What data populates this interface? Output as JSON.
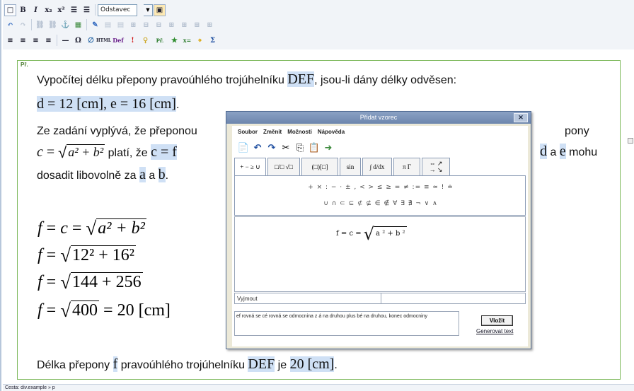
{
  "toolbar": {
    "row1": [
      "□",
      "B",
      "I",
      "x₂",
      "x²",
      "☰",
      "☰"
    ],
    "style_select_value": "Odstavec",
    "row2": [
      "↶",
      "↷",
      "⛓",
      "⛓",
      "⚓",
      "▦",
      "✎",
      "▤",
      "▤",
      "⊞",
      "⊟",
      "⊟",
      "⊞",
      "⊞",
      "⊞",
      "⊞"
    ],
    "row3": [
      "≡",
      "≡",
      "≡",
      "≡",
      "—",
      "Ω",
      "∅",
      "HTML",
      "Def",
      "!",
      "♀",
      "Př.",
      "★",
      "x=",
      "⋄",
      "Σ"
    ]
  },
  "content": {
    "example_tag": "Př.",
    "task_text_pre": "Vypočítej délku přepony pravoúhlého trojúhelníku ",
    "task_triangle": "DEF",
    "task_text_post": ", jsou-li dány délky odvěsen:",
    "given": "d = 12 [cm], e = 16 [cm]",
    "given_end": ".",
    "line3_left": "Ze zadání vyplývá, že přeponou",
    "line3_right": "pony",
    "line4_c": "c",
    "line4_mid": " platí, že ",
    "line4_highlight": "c = f",
    "line4_d": "d",
    "line4_a": " a ",
    "line4_e": "e",
    "line4_end": " mohu",
    "line5_pre": "dosadit libovolně za ",
    "line5_a": "a",
    "line5_mid": " a ",
    "line5_b": "b",
    "line5_end": ".",
    "eq1_f": "f",
    "eq1_eq": "=",
    "eq1_c": "c",
    "eq1_eq2": "=",
    "eq1_rad": "a² + b²",
    "eq2_f": "f",
    "eq2_eq": "=",
    "eq2_rad": "12² + 16²",
    "eq3_f": "f",
    "eq3_eq": "=",
    "eq3_rad": "144 + 256",
    "eq4_f": "f",
    "eq4_eq": "=",
    "eq4_rad": "400",
    "eq4_rest": "= 20 [cm]",
    "answer_pre": "Délka přepony ",
    "answer_f": "f",
    "answer_mid": " pravoúhlého trojúhelníku ",
    "answer_triangle": "DEF",
    "answer_je": " je ",
    "answer_value": "20 [cm]",
    "answer_end": "."
  },
  "status_path": "Cesta: div.example » p",
  "dialog": {
    "title": "Přidat vzorec",
    "close": "✕",
    "menu": [
      "Soubor",
      "Změnit",
      "Možnosti",
      "Nápověda"
    ],
    "icons": [
      "📄",
      "↶",
      "↷",
      "✂",
      "⎘",
      "📋",
      "➜"
    ],
    "tabs": [
      "+ − ≥ ∪",
      "□/□ √□",
      "(□)[□]",
      "sin",
      "∫ d/dx",
      "π Γ",
      "⇔ ↗ → ↘"
    ],
    "palette_row1": "+ × : − · ± , < > ≤ ≥ = ≠ := ≡ ≃ ! ≐",
    "palette_row2": "∪ ∩ ⊂ ⊆ ⊄ ⊈ ∈ ∉ ∀ ∃ ∄ ¬ ∨ ∧",
    "preview_lhs": "f = c = ",
    "preview_rad": "a ² + b ²",
    "status_left": "Vyjmout",
    "readout": "ef rovná se cé rovná se odmocnina z á na druhou plus bé na druhou, konec odmocniny",
    "insert_label": "Vložit",
    "generate_label": "Generovat text"
  }
}
